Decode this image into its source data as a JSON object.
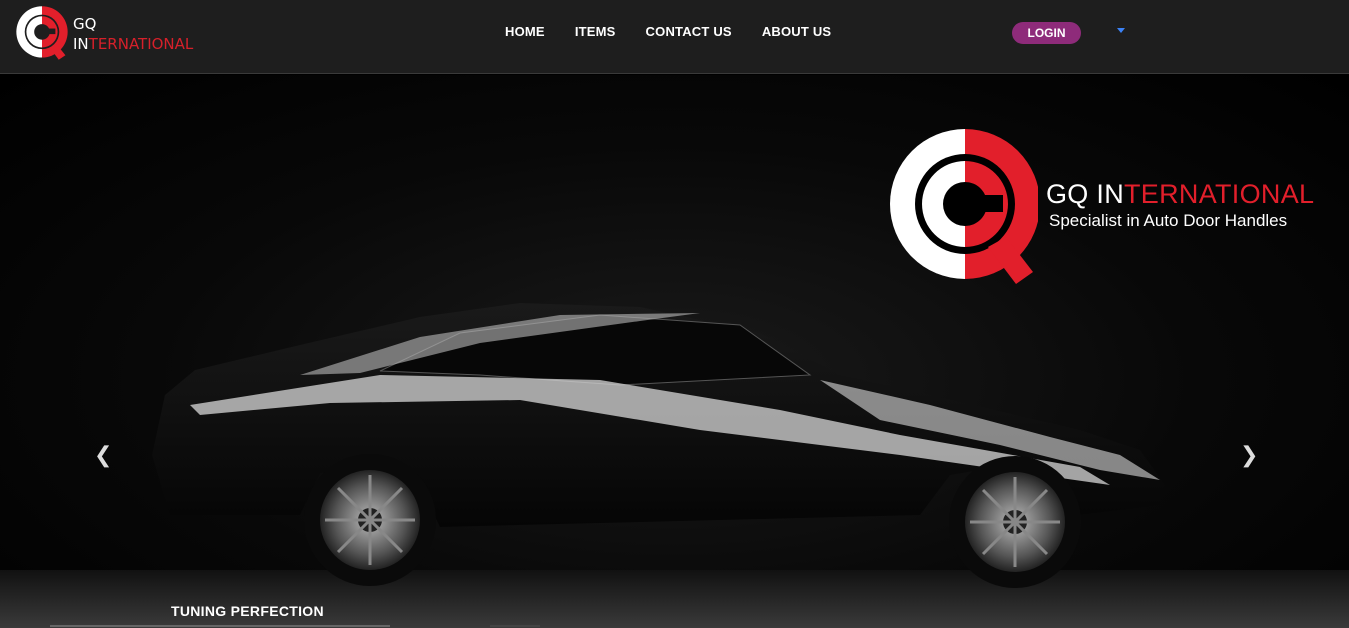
{
  "navbar": {
    "brand_line1": "GQ",
    "brand_line2_white": "IN",
    "brand_line2_red": "TERNATIONAL",
    "menu": [
      "HOME",
      "ITEMS",
      "CONTACT US",
      "ABOUT US"
    ],
    "login_label": "LOGIN"
  },
  "hero": {
    "brand_white": "GQ IN",
    "brand_red": "TERNATIONAL",
    "tagline": "Specialist in Auto Door Handles",
    "caption": "TUNING PERFECTION",
    "prev_icon": "chevron-left-icon",
    "next_icon": "chevron-right-icon"
  },
  "colors": {
    "brand_red": "#e21f2b",
    "login_bg": "#8e2b7a",
    "navbar_bg": "#1e1e1e",
    "caret": "#3b82f6"
  }
}
